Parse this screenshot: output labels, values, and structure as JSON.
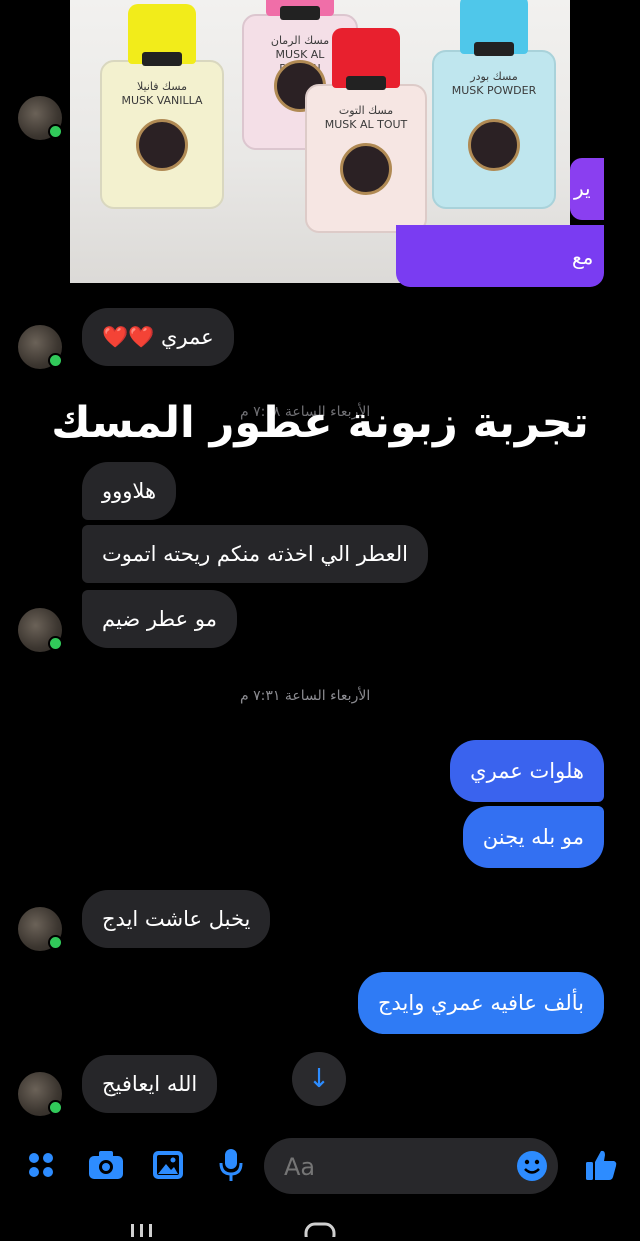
{
  "photo": {
    "bottles": [
      {
        "label_ar": "مسك فانيلا",
        "label_en": "MUSK VANILLA",
        "cap_color": "#f2ec1a",
        "body_color": "#f3f1cf"
      },
      {
        "label_ar": "مسك الرمان",
        "label_en": "MUSK AL ROMAN",
        "cap_color": "#f06ea8",
        "body_color": "#f4dfe7"
      },
      {
        "label_ar": "مسك التوت",
        "label_en": "MUSK AL TOUT",
        "cap_color": "#e8202e",
        "body_color": "#f6e6e3"
      },
      {
        "label_ar": "مسك بودر",
        "label_en": "MUSK POWDER",
        "cap_color": "#4fc7ea",
        "body_color": "#bfe6ee"
      }
    ]
  },
  "partial_outgoing": [
    "ير",
    "مع"
  ],
  "messages_top": {
    "omri_hearts": "عمري ❤️❤️"
  },
  "headline": "تجربة زبونة عطور المسك",
  "timestamp_1": "الأربعاء الساعة ٧:١٨ م",
  "incoming_group_1": [
    "هلاووو",
    "العطر الي اخذته منكم ريحته اتموت",
    "مو عطر ضيم"
  ],
  "timestamp_2": "الأربعاء الساعة ٧:٣١ م",
  "outgoing_group_1": [
    "هلوات عمري",
    "مو بله يجنن"
  ],
  "incoming_2": "يخبل عاشت ايدج",
  "outgoing_2": "بألف عافيه عمري وايدج",
  "incoming_3": "الله ايعافيج",
  "composer": {
    "placeholder": "Aa"
  },
  "colors": {
    "outgoing_bubble": "#3478f6",
    "incoming_bubble": "#262629",
    "accent": "#2d8cff",
    "online": "#31c95a"
  },
  "icons": [
    "grid-menu-icon",
    "camera-icon",
    "gallery-icon",
    "microphone-icon",
    "emoji-icon",
    "thumbs-up-icon",
    "arrow-down-icon"
  ]
}
